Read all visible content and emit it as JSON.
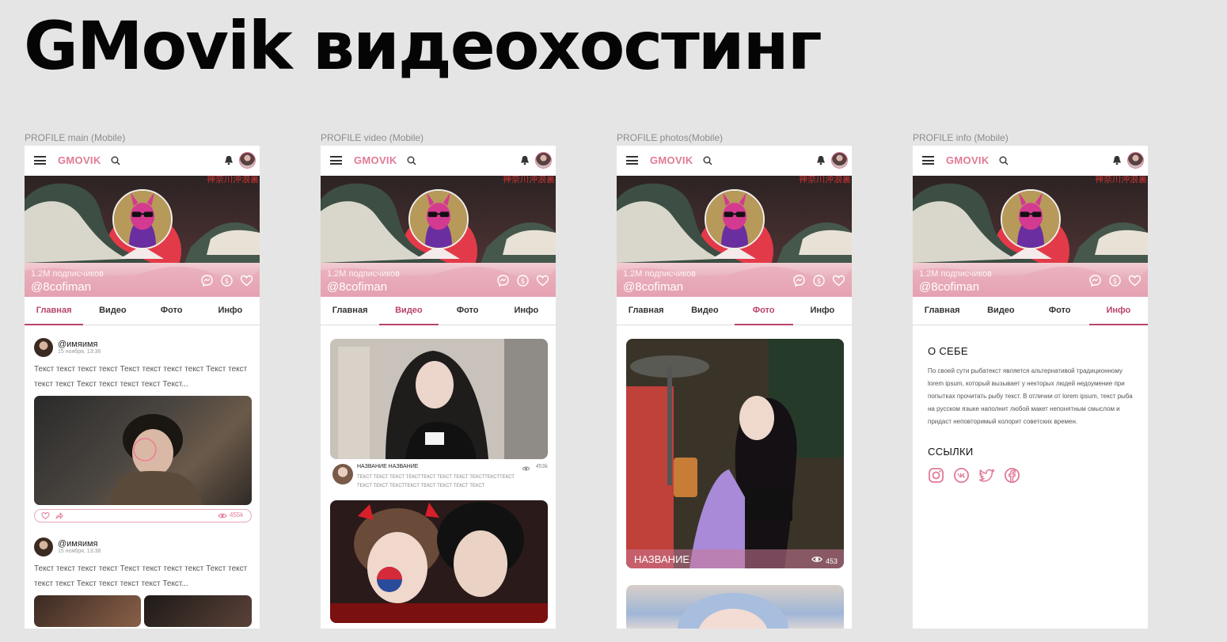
{
  "page": {
    "title": "GMovik видеохостинг"
  },
  "colors": {
    "accent": "#e17a96",
    "accent_dark": "#b8446b",
    "background": "#e5e5e5"
  },
  "header": {
    "logo": "GMOVIK",
    "icons": {
      "menu": "hamburger-icon",
      "search": "search-icon",
      "notifications": "bell-icon",
      "avatar": "avatar"
    }
  },
  "profile": {
    "subscribers": "1.2М подписчиков",
    "handle": "@8cofiman",
    "banner_icons": [
      "message-icon",
      "donate-icon",
      "heart-icon"
    ]
  },
  "tabs": [
    "Главная",
    "Видео",
    "Фото",
    "Инфо"
  ],
  "frames": [
    {
      "label": "PROFILE main (Mobile)",
      "active_tab": 0
    },
    {
      "label": "PROFILE video (Mobile)",
      "active_tab": 1
    },
    {
      "label": "PROFILE photos(Mobile)",
      "active_tab": 2
    },
    {
      "label": "PROFILE info (Mobile)",
      "active_tab": 3
    }
  ],
  "main": {
    "posts": [
      {
        "author": "@имяимя",
        "date": "15 ноября, 13:38",
        "text": "Текст текст текст текст Текст текст текст текст Текст текст текст текст Текст текст текст текст Текст...",
        "views": "455k"
      },
      {
        "author": "@имяимя",
        "date": "15 ноября, 13:38",
        "text": "Текст текст текст текст Текст текст текст текст Текст текст текст текст Текст текст текст текст Текст..."
      }
    ]
  },
  "video": {
    "items": [
      {
        "title": "НАЗВАНИЕ НАЗВАНИЕ",
        "description": "ТЕКСТ ТЕКСТ ТЕКСТ ТЕКСТТЕКСТ ТЕКСТ ТЕКСТ ТЕКСТТЕКСТТЕКСТ ТЕКСТ ТЕКСТ ТЕКСТТЕКСТ ТЕКСТ ТЕКСТ ТЕКСТ ТЕКСТ",
        "views": "453k"
      }
    ]
  },
  "photos": {
    "items": [
      {
        "caption": "НАЗВАНИЕ",
        "views": "453"
      }
    ]
  },
  "info": {
    "about_heading": "О СЕБЕ",
    "about_text": "По своей сути рыбатекст является альтернативой традиционному lorem ipsum, который вызывает у некторых людей недоумение при попытках прочитать рыбу текст. В отличии от lorem ipsum, текст рыба на русском языке наполнит любой макет непонятным смыслом и придаст неповторимый колорит советских времен.",
    "links_heading": "ССЫЛКИ",
    "social": [
      "instagram-icon",
      "vk-icon",
      "twitter-icon",
      "facebook-icon"
    ]
  }
}
